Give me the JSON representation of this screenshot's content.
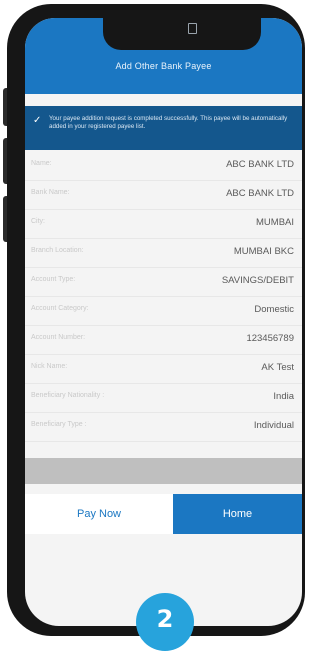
{
  "header": {
    "title": "Add Other Bank Payee"
  },
  "banner": {
    "icon": "check-icon",
    "message": "Your payee addition request is completed successfully. This payee will be automatically added in your registered payee list."
  },
  "details": [
    {
      "label": "Name:",
      "value": "ABC BANK LTD"
    },
    {
      "label": "Bank Name:",
      "value": "ABC BANK LTD"
    },
    {
      "label": "City:",
      "value": "MUMBAI"
    },
    {
      "label": "Branch Location:",
      "value": "MUMBAI BKC"
    },
    {
      "label": "Account Type:",
      "value": "SAVINGS/DEBIT"
    },
    {
      "label": "Account Category:",
      "value": "Domestic"
    },
    {
      "label": "Account Number:",
      "value": "123456789"
    },
    {
      "label": "Nick Name:",
      "value": "AK Test"
    },
    {
      "label": "Beneficiary Nationality :",
      "value": "India"
    },
    {
      "label": "Beneficiary Type :",
      "value": "Individual"
    }
  ],
  "actions": {
    "pay_now": "Pay Now",
    "home": "Home"
  },
  "step_badge": "2",
  "colors": {
    "primary": "#1b77c2",
    "banner": "#14578d",
    "badge": "#27a3dc"
  }
}
